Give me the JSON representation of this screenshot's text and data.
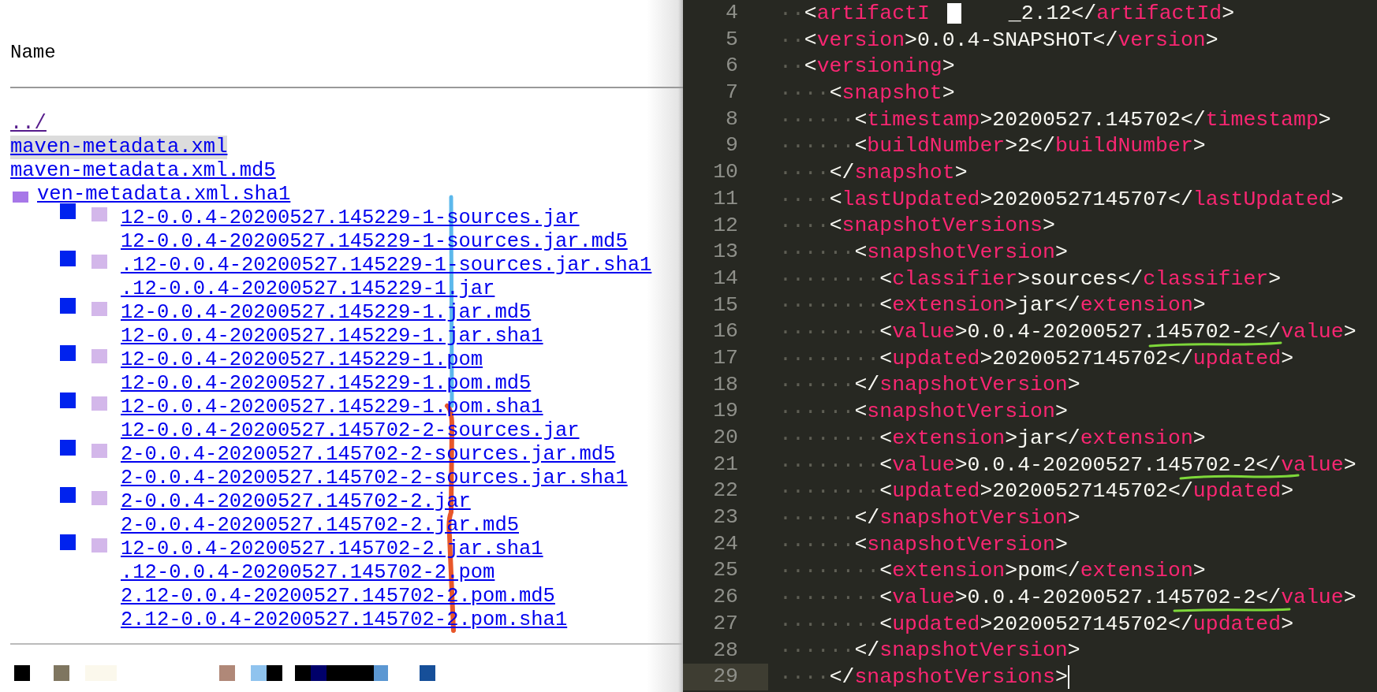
{
  "file_listing": {
    "column_header": "Name",
    "links": [
      {
        "text": "../",
        "visited": true,
        "highlighted": false,
        "kind": "plain"
      },
      {
        "text": "maven-metadata.xml",
        "visited": false,
        "highlighted": true,
        "kind": "plain"
      },
      {
        "text": "maven-metadata.xml.md5",
        "visited": false,
        "highlighted": false,
        "kind": "plain"
      },
      {
        "text": "ven-metadata.xml.sha1",
        "visited": false,
        "highlighted": false,
        "kind": "redacted"
      },
      {
        "text": "12-0.0.4-20200527.145229-1-sources.jar",
        "visited": false,
        "highlighted": false,
        "kind": "artifact"
      },
      {
        "text": "12-0.0.4-20200527.145229-1-sources.jar.md5",
        "visited": false,
        "highlighted": false,
        "kind": "artifact"
      },
      {
        "text": ".12-0.0.4-20200527.145229-1-sources.jar.sha1",
        "visited": false,
        "highlighted": false,
        "kind": "artifact"
      },
      {
        "text": ".12-0.0.4-20200527.145229-1.jar",
        "visited": false,
        "highlighted": false,
        "kind": "artifact"
      },
      {
        "text": "12-0.0.4-20200527.145229-1.jar.md5",
        "visited": false,
        "highlighted": false,
        "kind": "artifact"
      },
      {
        "text": "12-0.0.4-20200527.145229-1.jar.sha1",
        "visited": false,
        "highlighted": false,
        "kind": "artifact"
      },
      {
        "text": "12-0.0.4-20200527.145229-1.pom",
        "visited": false,
        "highlighted": false,
        "kind": "artifact"
      },
      {
        "text": "12-0.0.4-20200527.145229-1.pom.md5",
        "visited": false,
        "highlighted": false,
        "kind": "artifact"
      },
      {
        "text": "12-0.0.4-20200527.145229-1.pom.sha1",
        "visited": false,
        "highlighted": false,
        "kind": "artifact"
      },
      {
        "text": "12-0.0.4-20200527.145702-2-sources.jar",
        "visited": false,
        "highlighted": false,
        "kind": "artifact"
      },
      {
        "text": "2-0.0.4-20200527.145702-2-sources.jar.md5",
        "visited": false,
        "highlighted": false,
        "kind": "artifact"
      },
      {
        "text": "2-0.0.4-20200527.145702-2-sources.jar.sha1",
        "visited": false,
        "highlighted": false,
        "kind": "artifact"
      },
      {
        "text": "2-0.0.4-20200527.145702-2.jar",
        "visited": false,
        "highlighted": false,
        "kind": "artifact"
      },
      {
        "text": "2-0.0.4-20200527.145702-2.jar.md5",
        "visited": false,
        "highlighted": false,
        "kind": "artifact"
      },
      {
        "text": "12-0.0.4-20200527.145702-2.jar.sha1",
        "visited": false,
        "highlighted": false,
        "kind": "artifact"
      },
      {
        "text": ".12-0.0.4-20200527.145702-2.pom",
        "visited": false,
        "highlighted": false,
        "kind": "artifact"
      },
      {
        "text": "2.12-0.0.4-20200527.145702-2.pom.md5",
        "visited": false,
        "highlighted": false,
        "kind": "artifact"
      },
      {
        "text": "2.12-0.0.4-20200527.145702-2.pom.sha1",
        "visited": false,
        "highlighted": false,
        "kind": "artifact"
      }
    ]
  },
  "editor": {
    "lines": [
      {
        "number": "4",
        "parts": [
          "··<artifactI",
          "_2.12</artifactId>"
        ],
        "current": false
      },
      {
        "number": "5",
        "parts": [
          "··<version>0.0.4-SNAPSHOT</version>"
        ],
        "current": false
      },
      {
        "number": "6",
        "parts": [
          "··<versioning>"
        ],
        "current": false
      },
      {
        "number": "7",
        "parts": [
          "····<snapshot>"
        ],
        "current": false
      },
      {
        "number": "8",
        "parts": [
          "······<timestamp>20200527.145702</timestamp>"
        ],
        "current": false
      },
      {
        "number": "9",
        "parts": [
          "······<buildNumber>2</buildNumber>"
        ],
        "current": false
      },
      {
        "number": "10",
        "parts": [
          "····</snapshot>"
        ],
        "current": false
      },
      {
        "number": "11",
        "parts": [
          "····<lastUpdated>20200527145707</lastUpdated>"
        ],
        "current": false
      },
      {
        "number": "12",
        "parts": [
          "····<snapshotVersions>"
        ],
        "current": false
      },
      {
        "number": "13",
        "parts": [
          "······<snapshotVersion>"
        ],
        "current": false
      },
      {
        "number": "14",
        "parts": [
          "········<classifier>sources</classifier>"
        ],
        "current": false
      },
      {
        "number": "15",
        "parts": [
          "········<extension>jar</extension>"
        ],
        "current": false
      },
      {
        "number": "16",
        "parts": [
          "········<value>0.0.4-20200527.145702-2</value>"
        ],
        "current": false
      },
      {
        "number": "17",
        "parts": [
          "········<updated>20200527145702</updated>"
        ],
        "current": false
      },
      {
        "number": "18",
        "parts": [
          "······</snapshotVersion>"
        ],
        "current": false
      },
      {
        "number": "19",
        "parts": [
          "······<snapshotVersion>"
        ],
        "current": false
      },
      {
        "number": "20",
        "parts": [
          "········<extension>jar</extension>"
        ],
        "current": false
      },
      {
        "number": "21",
        "parts": [
          "········<value>0.0.4-20200527.145702-2</value>"
        ],
        "current": false
      },
      {
        "number": "22",
        "parts": [
          "········<updated>20200527145702</updated>"
        ],
        "current": false
      },
      {
        "number": "23",
        "parts": [
          "······</snapshotVersion>"
        ],
        "current": false
      },
      {
        "number": "24",
        "parts": [
          "······<snapshotVersion>"
        ],
        "current": false
      },
      {
        "number": "25",
        "parts": [
          "········<extension>pom</extension>"
        ],
        "current": false
      },
      {
        "number": "26",
        "parts": [
          "········<value>0.0.4-20200527.145702-2</value>"
        ],
        "current": false
      },
      {
        "number": "27",
        "parts": [
          "········<updated>20200527145702</updated>"
        ],
        "current": false
      },
      {
        "number": "28",
        "parts": [
          "······</snapshotVersion>"
        ],
        "current": false
      },
      {
        "number": "29",
        "parts": [
          "····</snapshotVersions>"
        ],
        "current": true
      }
    ]
  }
}
